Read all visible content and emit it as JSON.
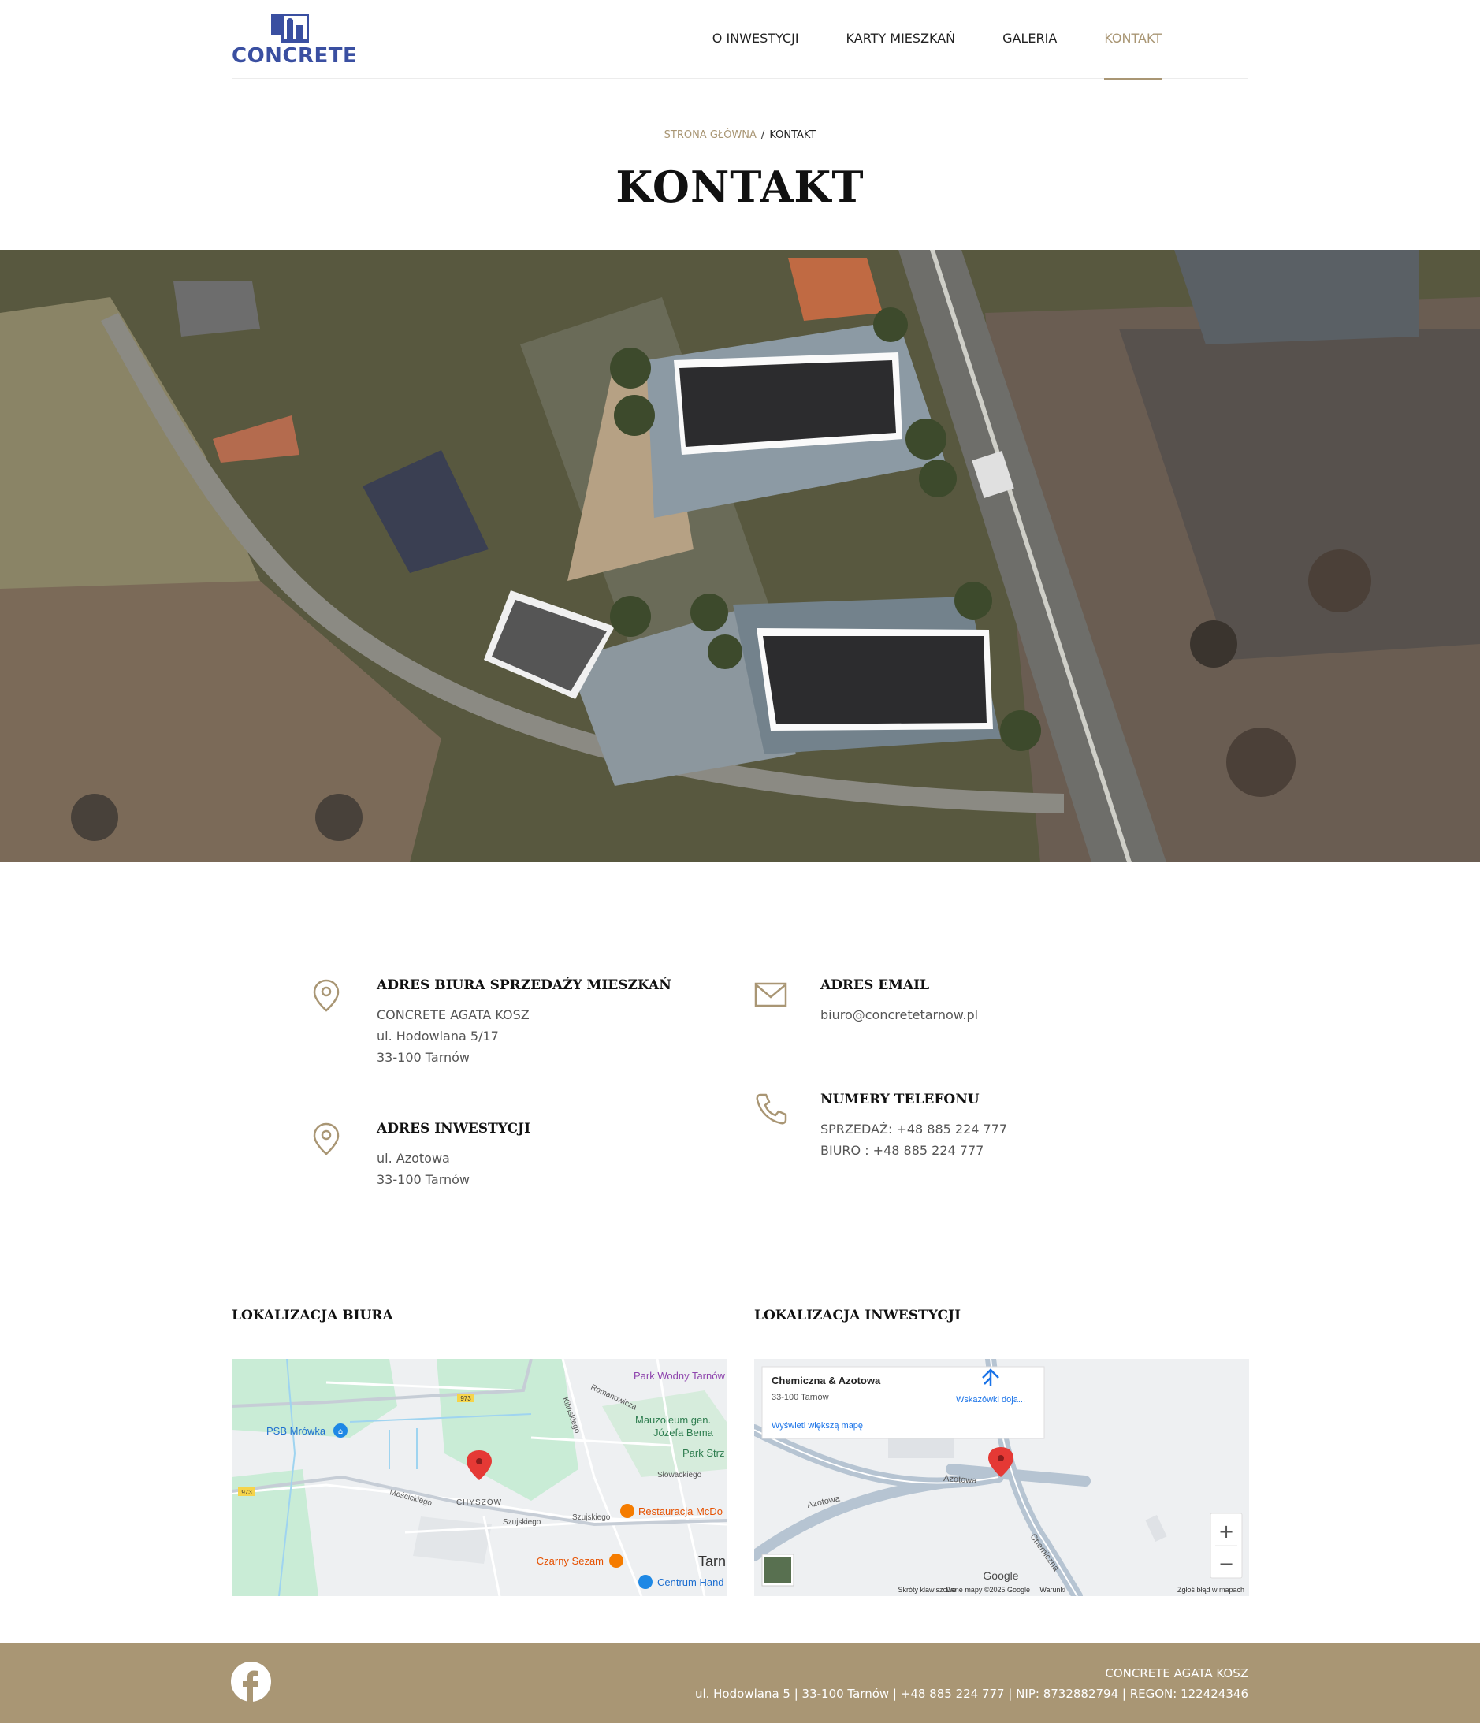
{
  "header": {
    "logo_text": "CONCRETE",
    "nav": [
      {
        "label": "O INWESTYCJI"
      },
      {
        "label": "KARTY MIESZKAŃ"
      },
      {
        "label": "GALERIA"
      },
      {
        "label": "KONTAKT"
      }
    ],
    "active_nav": "KONTAKT"
  },
  "breadcrumb": {
    "home": "STRONA GŁÓWNA",
    "separator": "/",
    "current": "KONTAKT"
  },
  "page_title": "KONTAKT",
  "contact": {
    "office": {
      "title": "ADRES BIURA SPRZEDAŻY MIESZKAŃ",
      "lines": [
        "CONCRETE AGATA KOSZ",
        "ul. Hodowlana 5/17",
        "33-100 Tarnów"
      ],
      "icon": "map-pin-icon"
    },
    "investment": {
      "title": "ADRES INWESTYCJI",
      "lines": [
        "ul. Azotowa",
        "33-100 Tarnów"
      ],
      "icon": "map-pin-icon"
    },
    "email": {
      "title": "ADRES EMAIL",
      "lines": [
        "biuro@concretetarnow.pl"
      ],
      "icon": "envelope-icon"
    },
    "phones": {
      "title": "NUMERY TELEFONU",
      "lines": [
        "SPRZEDAŻ: +48 885 224 777",
        "BIURO : +48 885 224 777"
      ],
      "icon": "phone-icon"
    }
  },
  "locations": {
    "office_title": "LOKALIZACJA BIURA",
    "investment_title": "LOKALIZACJA INWESTYCJI"
  },
  "office_map": {
    "labels": {
      "park_wodny": "Park Wodny Tarnów",
      "romanowicza": "Romanowicza",
      "kilinskiego": "Kilińskiego",
      "mauzoleum_1": "Mauzoleum gen.",
      "mauzoleum_2": "Józefa Bema",
      "park_strz": "Park Strz",
      "slowackiego": "Słowackiego",
      "psb": "PSB Mrówka",
      "chyszow": "CHYSZÓW",
      "moscickiego": "Mościckiego",
      "szujskiego_1": "Szujskiego",
      "szujskiego_2": "Szujskiego",
      "restauracja": "Restauracja McDo",
      "czarny_sezam": "Czarny Sezam",
      "tarn": "Tarn",
      "centrum": "Centrum Hand",
      "road_973_a": "973",
      "road_973_b": "973"
    }
  },
  "investment_map": {
    "card_title": "Chemiczna & Azotowa",
    "card_subtitle": "33-100 Tarnów",
    "directions": "Wskazówki doja...",
    "bigger_map": "Wyświetl większą mapę",
    "azotowa_1": "Azotowa",
    "azotowa_2": "Azotowa",
    "chemiczna": "Chemiczna",
    "google": "Google",
    "zoom_in": "+",
    "zoom_out": "−",
    "attrib": {
      "shortcuts": "Skróty klawiszowe",
      "data": "Dane mapy ©2025 Google",
      "terms": "Warunki",
      "report": "Zgłoś błąd w mapach"
    }
  },
  "footer": {
    "company": "CONCRETE AGATA KOSZ",
    "details": "ul. Hodowlana 5 | 33-100 Tarnów | +48 885 224 777 | NIP: 8732882794 | REGON:  122424346",
    "icon": "facebook-icon"
  },
  "colors": {
    "accent": "#a99674",
    "logo": "#3a4fa1",
    "footer_bg": "#a99674"
  }
}
